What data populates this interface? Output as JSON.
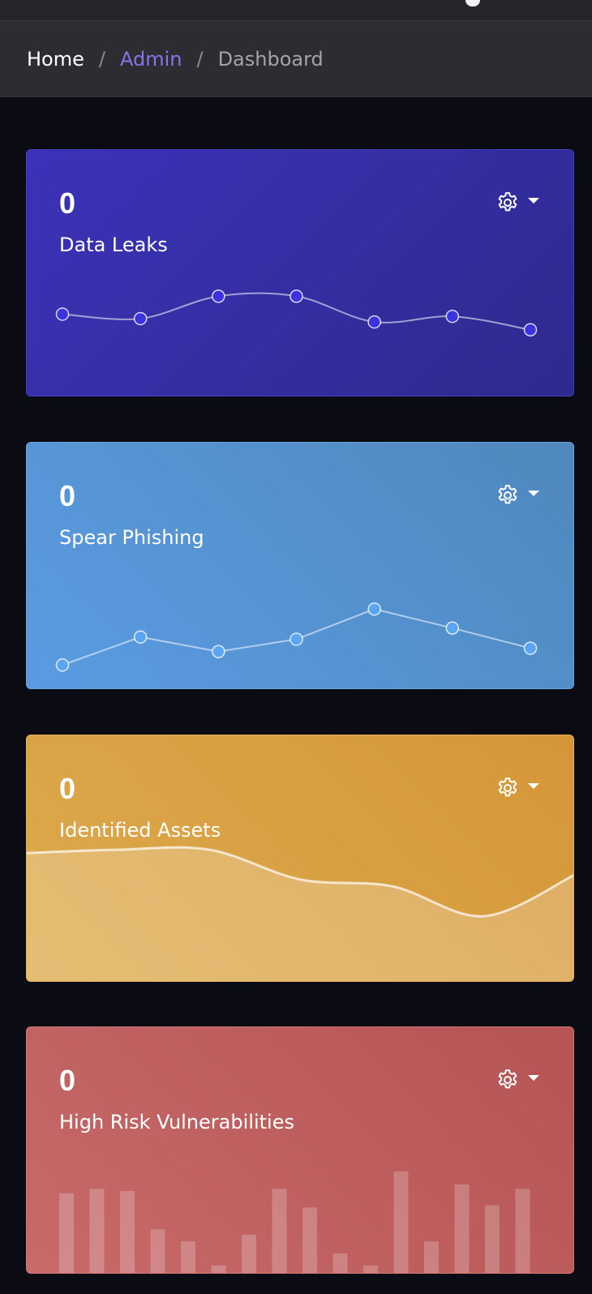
{
  "breadcrumb": {
    "home": "Home",
    "admin": "Admin",
    "current": "Dashboard",
    "separator": "/"
  },
  "cards": [
    {
      "value": "0",
      "label": "Data Leaks",
      "icon": "gear-icon",
      "color": "#3b32b8",
      "chart_data": {
        "type": "line",
        "values": [
          62,
          58,
          78,
          78,
          55,
          60,
          48
        ]
      }
    },
    {
      "value": "0",
      "label": "Spear Phishing",
      "icon": "gear-icon",
      "color": "#5a9be2",
      "chart_data": {
        "type": "line",
        "values": [
          10,
          35,
          22,
          33,
          60,
          43,
          25
        ]
      }
    },
    {
      "value": "0",
      "label": "Identified Assets",
      "icon": "gear-icon",
      "color": "#d59638",
      "chart_data": {
        "type": "area",
        "values": [
          78,
          80,
          80,
          62,
          58,
          40,
          65
        ]
      }
    },
    {
      "value": "0",
      "label": "High Risk Vulnerabilities",
      "icon": "gear-icon",
      "color": "#c86a6a",
      "chart_data": {
        "type": "bar",
        "values": [
          78,
          82,
          80,
          45,
          34,
          12,
          40,
          82,
          65,
          23,
          12,
          98,
          34,
          86,
          67,
          82
        ]
      }
    }
  ]
}
